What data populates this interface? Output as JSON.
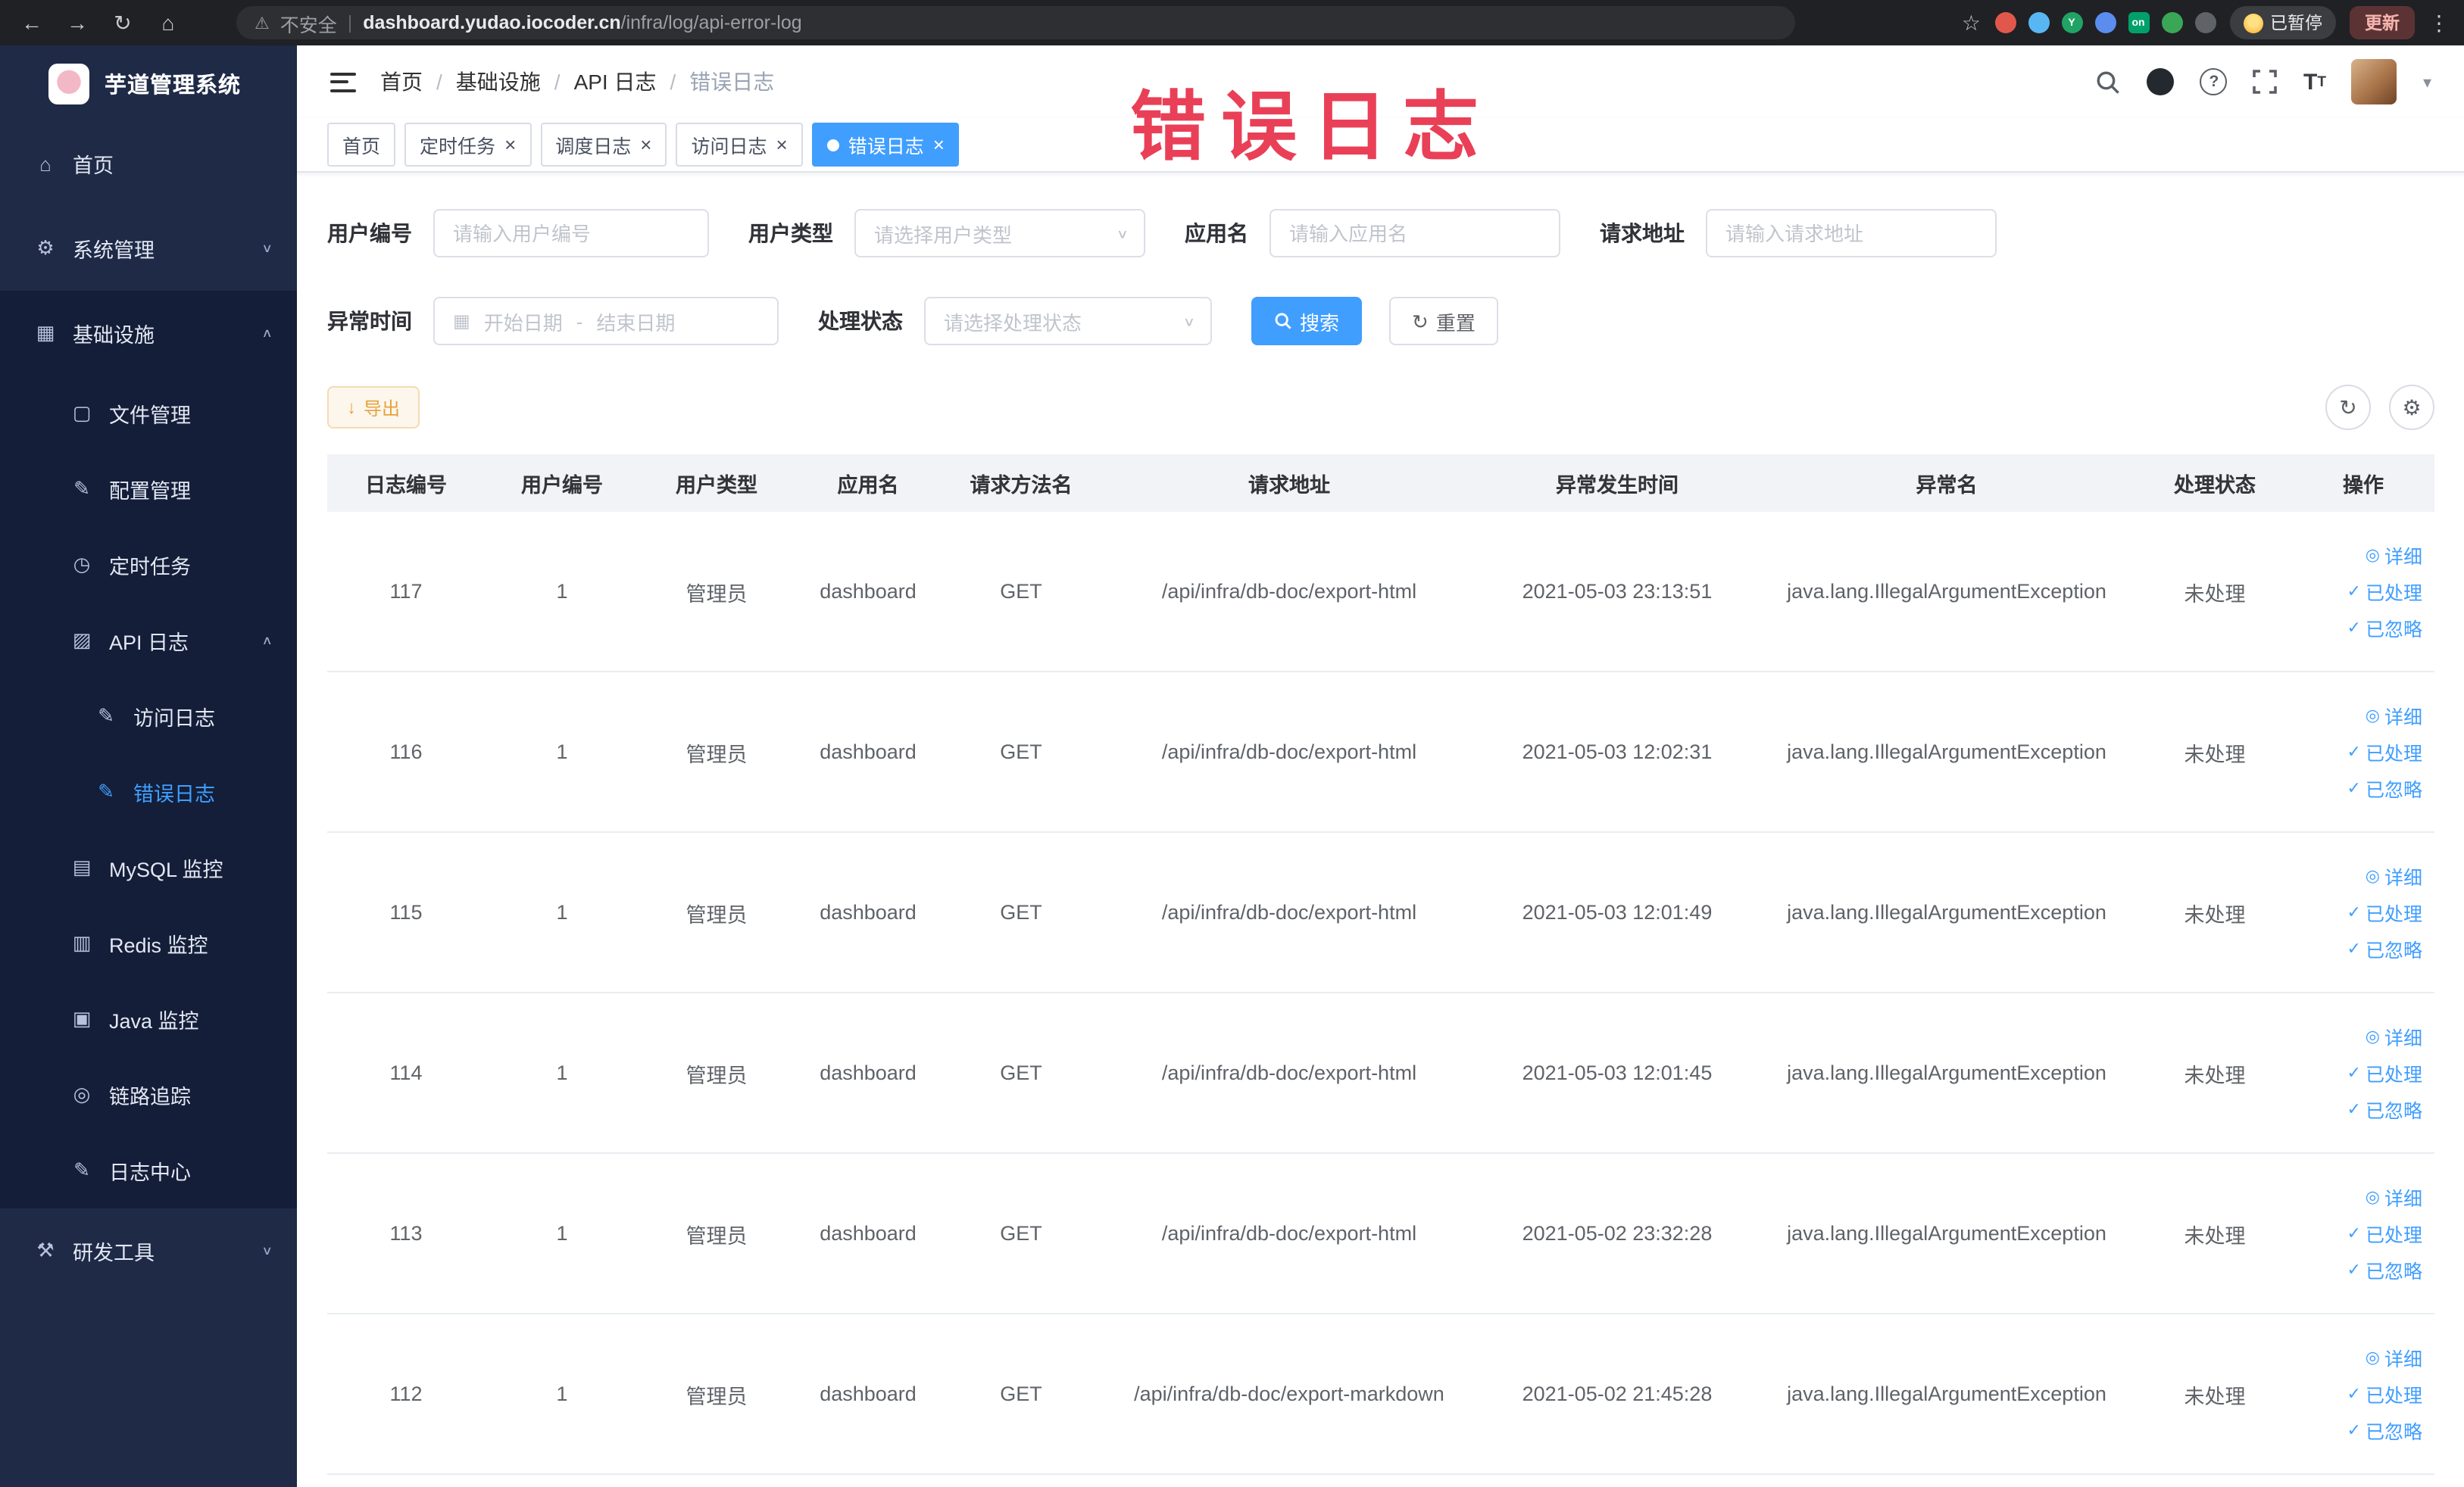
{
  "browser": {
    "security_label": "不安全",
    "url_domain": "dashboard.yudao.iocoder.cn",
    "url_path": "/infra/log/api-error-log",
    "paused_badge": "已暂停",
    "update_button": "更新",
    "extensions": [
      {
        "name": "extension-red-icon",
        "color": "#e2574c"
      },
      {
        "name": "extension-drop-icon",
        "color": "#58b7f2"
      },
      {
        "name": "extension-green-circle-icon",
        "color": "#21a366",
        "text": "Y"
      },
      {
        "name": "extension-grid-icon",
        "color": "#5b8def"
      },
      {
        "name": "extension-on-badge-icon",
        "color": "#00a06a",
        "text": "on"
      },
      {
        "name": "extension-leaf-icon",
        "color": "#3aa757"
      },
      {
        "name": "extension-paw-icon",
        "color": "#5f6368"
      }
    ]
  },
  "watermark": "错误日志",
  "sidebar": {
    "logo_title": "芋道管理系统",
    "items": [
      {
        "label": "首页",
        "icon": "home-icon",
        "level": 1
      },
      {
        "label": "系统管理",
        "icon": "gear-icon",
        "level": 1,
        "chevron": "down"
      },
      {
        "label": "基础设施",
        "icon": "infra-icon",
        "level": 1,
        "chevron": "up",
        "section": true
      },
      {
        "label": "文件管理",
        "icon": "file-icon",
        "level": 2,
        "section": true
      },
      {
        "label": "配置管理",
        "icon": "config-icon",
        "level": 2,
        "section": true
      },
      {
        "label": "定时任务",
        "icon": "timer-icon",
        "level": 2,
        "section": true
      },
      {
        "label": "API 日志",
        "icon": "api-log-icon",
        "level": 2,
        "chevron": "up",
        "section": true
      },
      {
        "label": "访问日志",
        "icon": "access-log-icon",
        "level": 3,
        "section": true
      },
      {
        "label": "错误日志",
        "icon": "error-log-icon",
        "level": 3,
        "section": true,
        "active": true
      },
      {
        "label": "MySQL 监控",
        "icon": "mysql-icon",
        "level": 2,
        "section": true
      },
      {
        "label": "Redis 监控",
        "icon": "redis-icon",
        "level": 2,
        "section": true
      },
      {
        "label": "Java 监控",
        "icon": "java-icon",
        "level": 2,
        "section": true
      },
      {
        "label": "链路追踪",
        "icon": "trace-icon",
        "level": 2,
        "section": true
      },
      {
        "label": "日志中心",
        "icon": "log-center-icon",
        "level": 2,
        "section": true
      },
      {
        "label": "研发工具",
        "icon": "devtools-icon",
        "level": 1,
        "chevron": "down"
      }
    ]
  },
  "header": {
    "breadcrumb": [
      "首页",
      "基础设施",
      "API 日志",
      "错误日志"
    ]
  },
  "tabs": [
    {
      "label": "首页",
      "closable": false,
      "active": false
    },
    {
      "label": "定时任务",
      "closable": true,
      "active": false
    },
    {
      "label": "调度日志",
      "closable": true,
      "active": false
    },
    {
      "label": "访问日志",
      "closable": true,
      "active": false
    },
    {
      "label": "错误日志",
      "closable": true,
      "active": true
    }
  ],
  "filters": {
    "user_id_label": "用户编号",
    "user_id_placeholder": "请输入用户编号",
    "user_type_label": "用户类型",
    "user_type_placeholder": "请选择用户类型",
    "app_name_label": "应用名",
    "app_name_placeholder": "请输入应用名",
    "request_url_label": "请求地址",
    "request_url_placeholder": "请输入请求地址",
    "exception_time_label": "异常时间",
    "date_start_placeholder": "开始日期",
    "date_separator": "-",
    "date_end_placeholder": "结束日期",
    "process_status_label": "处理状态",
    "process_status_placeholder": "请选择处理状态",
    "search_label": "搜索",
    "reset_label": "重置"
  },
  "toolbar": {
    "export_label": "导出"
  },
  "table": {
    "columns": [
      "日志编号",
      "用户编号",
      "用户类型",
      "应用名",
      "请求方法名",
      "请求地址",
      "异常发生时间",
      "异常名",
      "处理状态",
      "操作"
    ],
    "actions": [
      {
        "label": "详细",
        "icon": "eye-icon"
      },
      {
        "label": "已处理",
        "icon": "check-icon"
      },
      {
        "label": "已忽略",
        "icon": "check-icon"
      }
    ],
    "rows": [
      [
        "117",
        "1",
        "管理员",
        "dashboard",
        "GET",
        "/api/infra/db-doc/export-html",
        "2021-05-03 23:13:51",
        "java.lang.IllegalArgumentException",
        "未处理"
      ],
      [
        "116",
        "1",
        "管理员",
        "dashboard",
        "GET",
        "/api/infra/db-doc/export-html",
        "2021-05-03 12:02:31",
        "java.lang.IllegalArgumentException",
        "未处理"
      ],
      [
        "115",
        "1",
        "管理员",
        "dashboard",
        "GET",
        "/api/infra/db-doc/export-html",
        "2021-05-03 12:01:49",
        "java.lang.IllegalArgumentException",
        "未处理"
      ],
      [
        "114",
        "1",
        "管理员",
        "dashboard",
        "GET",
        "/api/infra/db-doc/export-html",
        "2021-05-03 12:01:45",
        "java.lang.IllegalArgumentException",
        "未处理"
      ],
      [
        "113",
        "1",
        "管理员",
        "dashboard",
        "GET",
        "/api/infra/db-doc/export-html",
        "2021-05-02 23:32:28",
        "java.lang.IllegalArgumentException",
        "未处理"
      ],
      [
        "112",
        "1",
        "管理员",
        "dashboard",
        "GET",
        "/api/infra/db-doc/export-markdown",
        "2021-05-02 21:45:28",
        "java.lang.IllegalArgumentException",
        "未处理"
      ]
    ]
  }
}
